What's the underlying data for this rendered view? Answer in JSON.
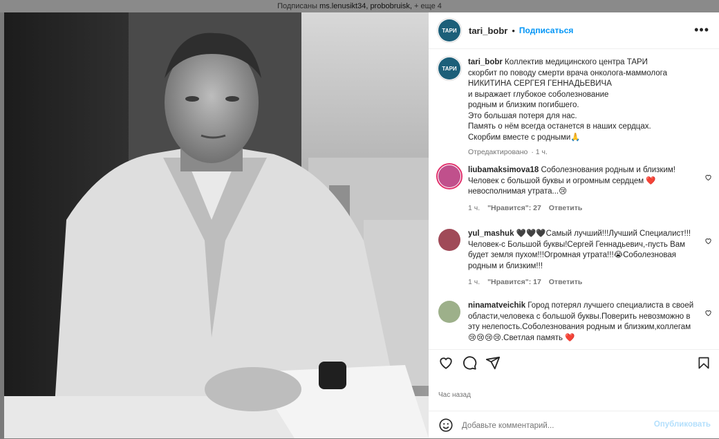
{
  "topbar": {
    "prefix": "Подписаны",
    "names": "ms.lenusikt34, probobruisk,",
    "more": "+ еще 4"
  },
  "post": {
    "author": "tari_bobr",
    "avatar_text": "ТАРИ",
    "follow_label": "Подписаться",
    "dot": "•",
    "more_label": "•••"
  },
  "caption": {
    "username": "tari_bobr",
    "lines": [
      "Коллектив медицинского центра ТАРИ",
      "скорбит по поводу смерти врача онколога-маммолога",
      "НИКИТИНА СЕРГЕЯ ГЕННАДЬЕВИЧА",
      "и выражает глубокое соболезнование",
      "родным и близким погибшего.",
      "Это большая потеря для нас.",
      "Память о нём всегда останется в наших сердцах.",
      "Скорбим вместе с родными🙏"
    ],
    "edited": "Отредактировано",
    "time": "1 ч."
  },
  "comments": [
    {
      "username": "liubamaksimova18",
      "text": "Соболезнования родным и близким! Человек с большой буквы и огромным сердцем ❤️ невосполнимая утрата...😢",
      "time": "1 ч.",
      "likes": "\"Нравится\": 27",
      "reply": "Ответить"
    },
    {
      "username": "yul_mashuk",
      "text": "🖤🖤🖤Самый лучший!!!Лучший Специалист!!! Человек-с Большой буквы!Сергей Геннадьевич,-пусть Вам будет земля пухом!!!Огромная утрата!!!😭Соболезновая родным и близким!!!",
      "time": "1 ч.",
      "likes": "\"Нравится\": 17",
      "reply": "Ответить"
    },
    {
      "username": "ninamatveichik",
      "text": "Город потерял лучшего специалиста в своей области,человека с большой буквы.Поверить невозможно в эту нелепость.Соболезнования родным и близким,коллегам😢😢😢😢.Светлая память ❤️"
    }
  ],
  "actions": {
    "like": "heart-outline-icon",
    "comment": "comment-bubble-icon",
    "share": "paper-plane-icon",
    "save": "bookmark-icon"
  },
  "timestamp": "Час назад",
  "add_comment": {
    "placeholder": "Добавьте комментарий...",
    "post_label": "Опубликовать"
  },
  "colors": {
    "accent": "#0095f6",
    "brand_avatar": "#1c5f79",
    "heart": "#e0243a"
  }
}
